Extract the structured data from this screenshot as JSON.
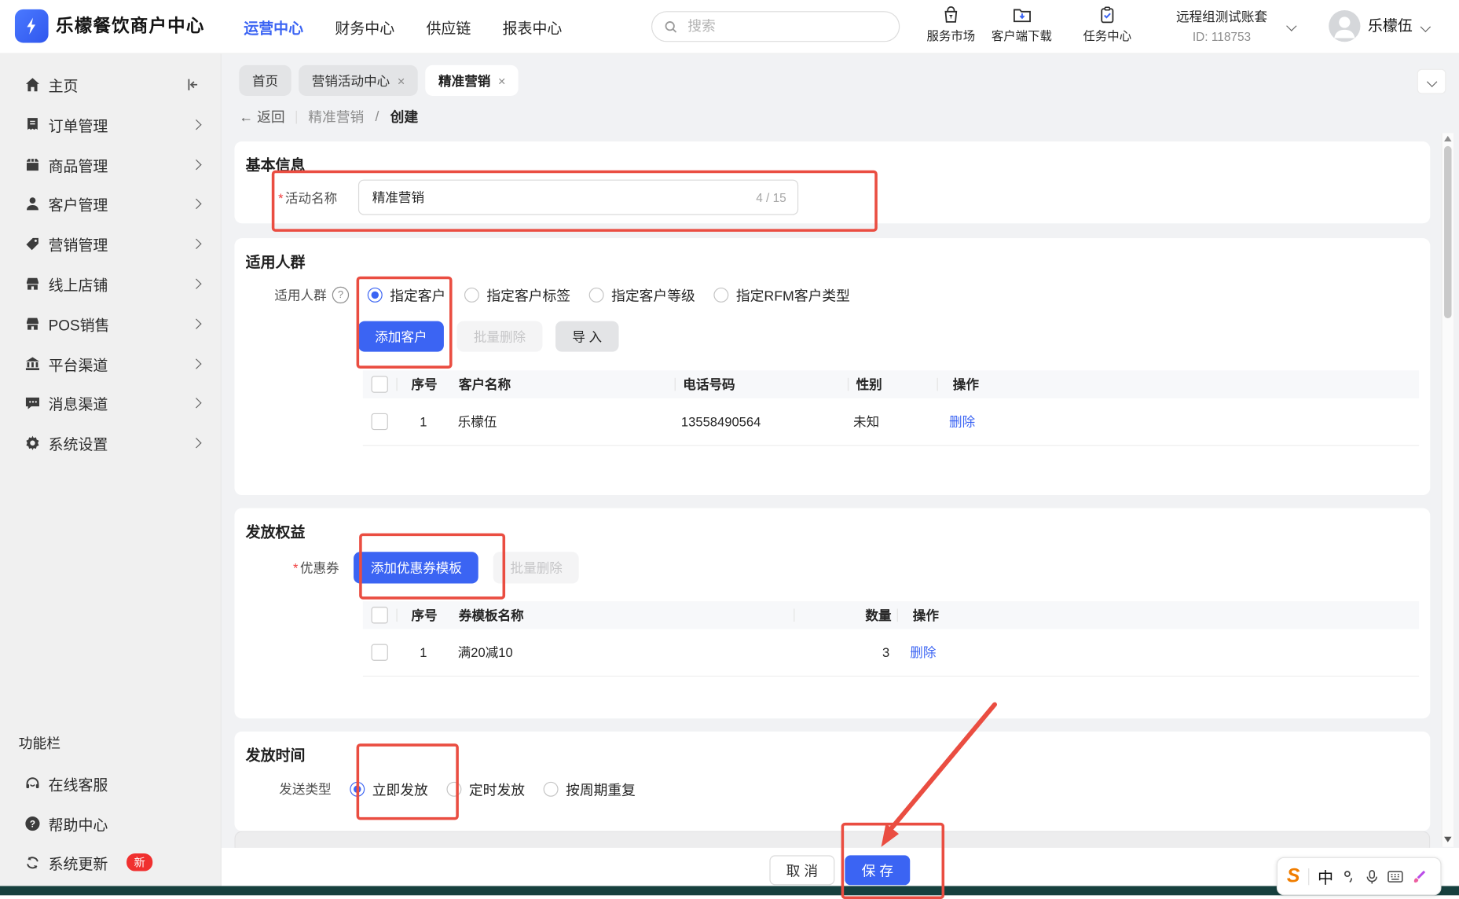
{
  "header": {
    "title": "乐檬餐饮商户中心",
    "nav": [
      {
        "label": "运营中心",
        "active": true
      },
      {
        "label": "财务中心",
        "active": false
      },
      {
        "label": "供应链",
        "active": false
      },
      {
        "label": "报表中心",
        "active": false
      }
    ],
    "search": {
      "placeholder": "搜索"
    },
    "tools": [
      {
        "label": "服务市场",
        "icon": "bag-icon"
      },
      {
        "label": "客户端下载",
        "icon": "folder-download-icon"
      },
      {
        "label": "任务中心",
        "icon": "clipboard-check-icon"
      }
    ],
    "account": {
      "name": "远程组测试账套",
      "id": "ID: 118753"
    },
    "user": {
      "name": "乐檬伍"
    }
  },
  "sidebar": {
    "items": [
      {
        "label": "主页",
        "icon": "home-icon",
        "expandable": false
      },
      {
        "label": "订单管理",
        "icon": "order-icon",
        "expandable": true
      },
      {
        "label": "商品管理",
        "icon": "product-icon",
        "expandable": true
      },
      {
        "label": "客户管理",
        "icon": "customer-icon",
        "expandable": true
      },
      {
        "label": "营销管理",
        "icon": "marketing-tag-icon",
        "expandable": true
      },
      {
        "label": "线上店铺",
        "icon": "store-icon",
        "expandable": true
      },
      {
        "label": "POS销售",
        "icon": "pos-store-icon",
        "expandable": true
      },
      {
        "label": "平台渠道",
        "icon": "bank-icon",
        "expandable": true
      },
      {
        "label": "消息渠道",
        "icon": "message-icon",
        "expandable": true
      },
      {
        "label": "系统设置",
        "icon": "gear-icon",
        "expandable": true
      }
    ],
    "footer_title": "功能栏",
    "footer": [
      {
        "label": "在线客服",
        "icon": "headset-icon"
      },
      {
        "label": "帮助中心",
        "icon": "question-circle-icon"
      },
      {
        "label": "系统更新",
        "icon": "refresh-icon",
        "badge": "新"
      }
    ]
  },
  "tabs": {
    "items": [
      {
        "label": "首页",
        "closable": false,
        "active": false
      },
      {
        "label": "营销活动中心",
        "closable": true,
        "active": false
      },
      {
        "label": "精准营销",
        "closable": true,
        "active": true
      }
    ],
    "close_glyph": "×"
  },
  "breadcrumb": {
    "back": "返回",
    "back_arrow": "←",
    "parent": "精准营销",
    "divider": "/",
    "current": "创建"
  },
  "basic": {
    "title": "基本信息",
    "required": "*",
    "label": "活动名称",
    "value": "精准营销",
    "counter": "4 / 15"
  },
  "audience": {
    "title": "适用人群",
    "label": "适用人群",
    "help_glyph": "?",
    "options": [
      {
        "label": "指定客户",
        "selected": true
      },
      {
        "label": "指定客户标签",
        "selected": false
      },
      {
        "label": "指定客户等级",
        "selected": false
      },
      {
        "label": "指定RFM客户类型",
        "selected": false
      }
    ],
    "add_button": "添加客户",
    "batch_delete_button": "批量删除",
    "import_button": "导 入",
    "table": {
      "col_index": "序号",
      "col_name": "客户名称",
      "col_phone": "电话号码",
      "col_gender": "性别",
      "col_action": "操作",
      "rows": [
        {
          "index": "1",
          "name": "乐檬伍",
          "phone": "13558490564",
          "gender": "未知",
          "action": "删除"
        }
      ]
    }
  },
  "benefits": {
    "title": "发放权益",
    "required": "*",
    "label": "优惠券",
    "add_button": "添加优惠券模板",
    "batch_delete_button": "批量删除",
    "table": {
      "col_index": "序号",
      "col_name": "券模板名称",
      "col_qty": "数量",
      "col_action": "操作",
      "rows": [
        {
          "index": "1",
          "name": "满20减10",
          "qty": "3",
          "action": "删除"
        }
      ]
    }
  },
  "timing": {
    "title": "发放时间",
    "label": "发送类型",
    "options": [
      {
        "label": "立即发放",
        "selected": true
      },
      {
        "label": "定时发放",
        "selected": false
      },
      {
        "label": "按周期重复",
        "selected": false
      }
    ]
  },
  "footer_bar": {
    "cancel": "取 消",
    "save": "保 存"
  },
  "ime": {
    "engine": "S",
    "lang": "中"
  },
  "colors": {
    "primary": "#3b64f3",
    "annotation_red": "#ea4d41",
    "badge_red": "#f0302f",
    "taskbar_teal": "#16403e",
    "link_blue": "#3b64f3",
    "sidebar_bg": "#f0f0f0",
    "content_bg": "#f1f2f4"
  }
}
